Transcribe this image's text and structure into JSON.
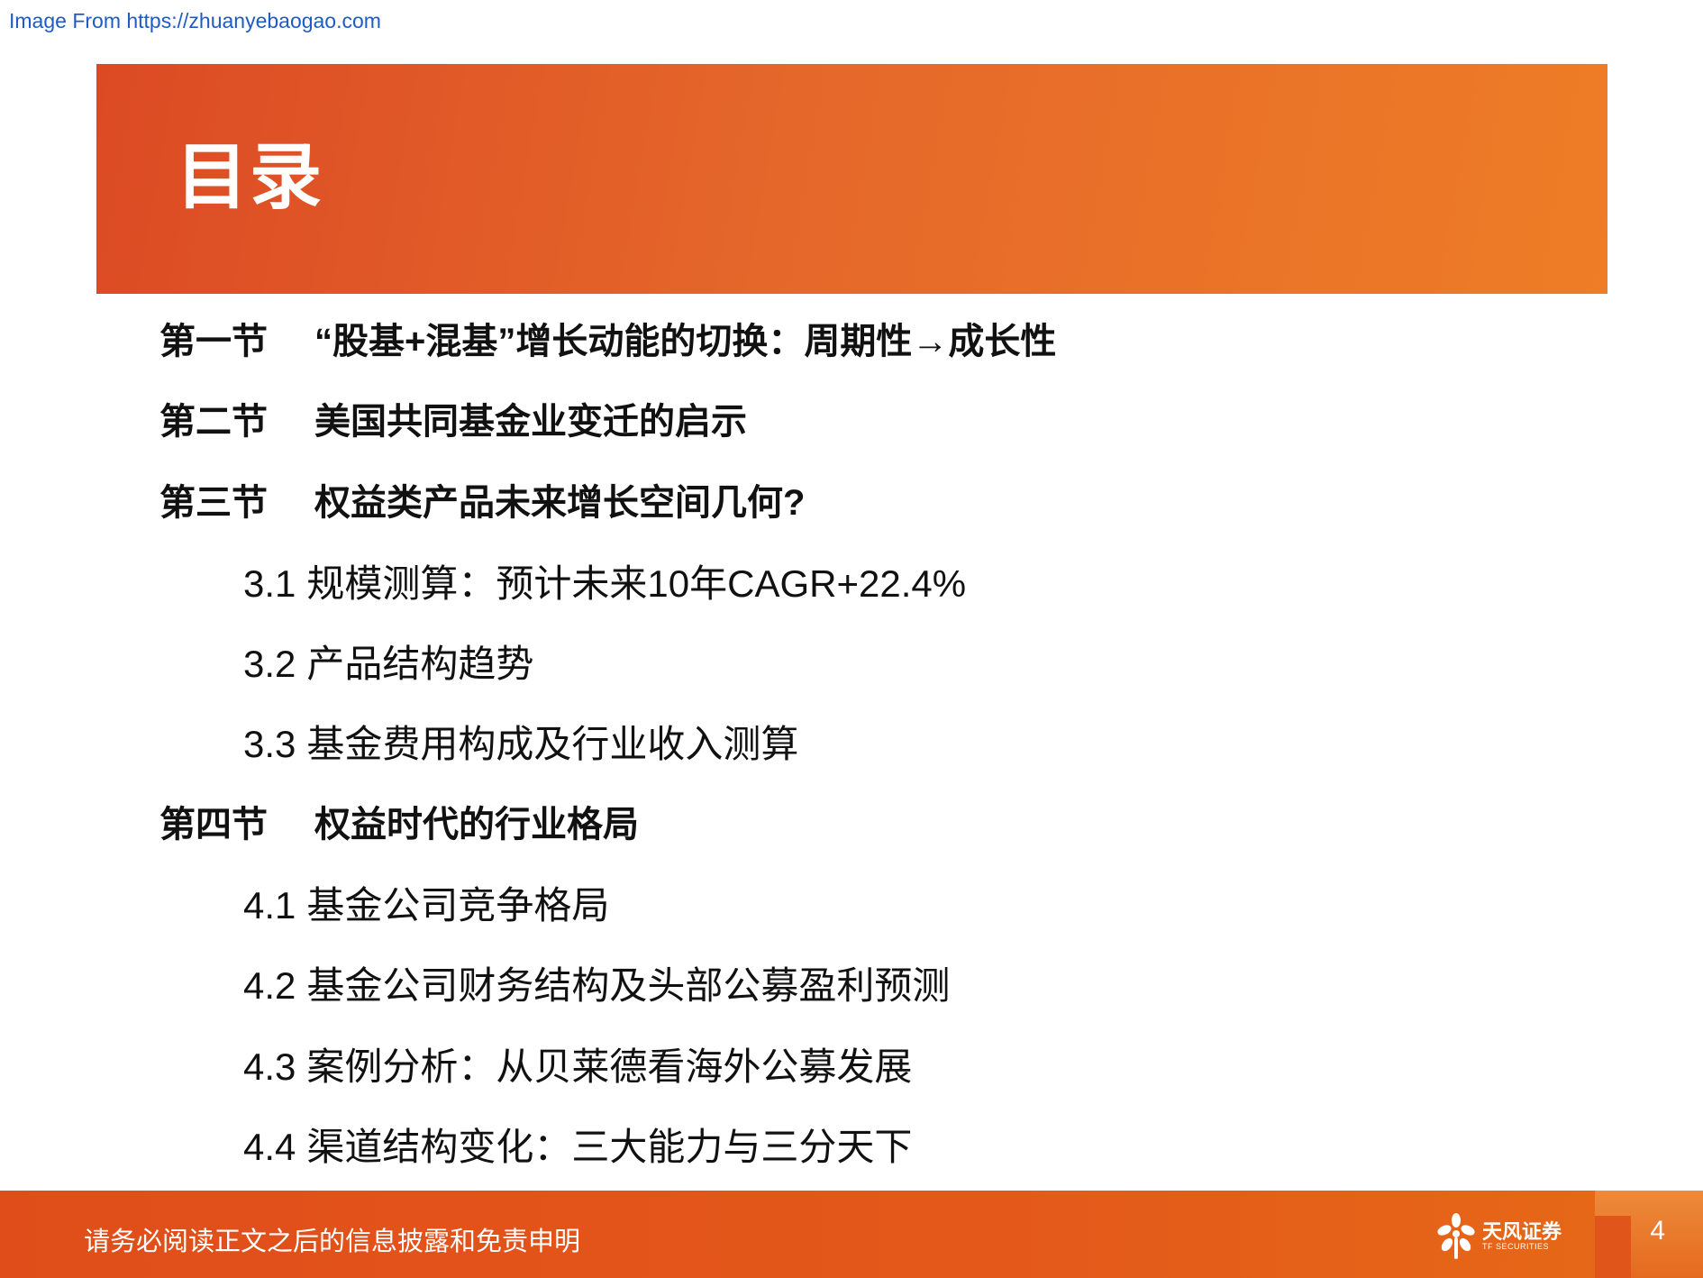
{
  "source_link": "Image From https://zhuanyebaogao.com",
  "header": {
    "title": "目录"
  },
  "toc": {
    "s1": {
      "num": "第一节",
      "title": "“股基+混基”增长动能的切换：周期性→成长性"
    },
    "s2": {
      "num": "第二节",
      "title": "美国共同基金业变迁的启示"
    },
    "s3": {
      "num": "第三节",
      "title": "权益类产品未来增长空间几何?"
    },
    "s3_1": {
      "num": "3.1",
      "title": "规模测算：预计未来10年CAGR+22.4%"
    },
    "s3_2": {
      "num": "3.2",
      "title": "产品结构趋势"
    },
    "s3_3": {
      "num": "3.3",
      "title": "基金费用构成及行业收入测算"
    },
    "s4": {
      "num": "第四节",
      "title": "权益时代的行业格局"
    },
    "s4_1": {
      "num": "4.1",
      "title": "基金公司竞争格局"
    },
    "s4_2": {
      "num": "4.2",
      "title": "基金公司财务结构及头部公募盈利预测"
    },
    "s4_3": {
      "num": "4.3",
      "title": "案例分析：从贝莱德看海外公募发展"
    },
    "s4_4": {
      "num": "4.4",
      "title": "渠道结构变化：三大能力与三分天下"
    }
  },
  "footer": {
    "disclaimer": "请务必阅读正文之后的信息披露和免责申明",
    "logo_cn": "天风证券",
    "logo_en": "TF SECURITIES",
    "page_number": "4"
  },
  "colors": {
    "banner_start": "#dc4a24",
    "banner_end": "#ee7d26",
    "footer": "#e4591a",
    "link": "#1f5bc4"
  }
}
